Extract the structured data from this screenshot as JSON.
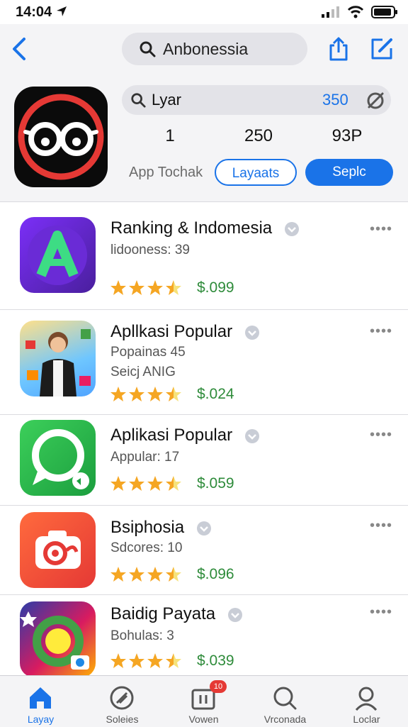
{
  "status": {
    "time": "14:04"
  },
  "header": {
    "search_text": "Anbonessia",
    "second_search_text": "Lyar",
    "second_search_count": "350",
    "stats": [
      "1",
      "250",
      "93P"
    ],
    "app_touch_label": "App Tochak",
    "buttons": {
      "layaats": "Layaats",
      "seplc": "Seplc"
    }
  },
  "rows": [
    {
      "title": "Ranking & Indomesia",
      "lines": [
        "lidooness: 39"
      ],
      "rating_stars": 3.5,
      "price": "$.099",
      "more": "••••"
    },
    {
      "title": "Apllkasi Popular",
      "lines": [
        "Popainas 45",
        "Seicj ANIG"
      ],
      "rating_stars": 3.5,
      "price": "$.024",
      "more": "••••"
    },
    {
      "title": "Aplikasi Popular",
      "lines": [
        "Appular: 17"
      ],
      "rating_stars": 3.5,
      "price": "$.059",
      "more": "••••"
    },
    {
      "title": "Bsiphosia",
      "lines": [
        "Sdcores: 10"
      ],
      "rating_stars": 3.5,
      "price": "$.096",
      "more": "••••"
    },
    {
      "title": "Baidig Payata",
      "lines": [
        "Bohulas: 3"
      ],
      "rating_stars": 3.5,
      "price": "$.039",
      "more": "••••"
    }
  ],
  "tabs": [
    {
      "label": "Layay",
      "icon": "home-icon",
      "active": true
    },
    {
      "label": "Soleies",
      "icon": "compass-slash-icon",
      "active": false
    },
    {
      "label": "Vowen",
      "icon": "pause-box-icon",
      "active": false,
      "badge": "10"
    },
    {
      "label": "Vrconada",
      "icon": "search-icon",
      "active": false
    },
    {
      "label": "Loclar",
      "icon": "person-icon",
      "active": false
    }
  ],
  "colors": {
    "accent": "#1a73e8",
    "price": "#2e8b3a",
    "star": "#f5a623"
  }
}
